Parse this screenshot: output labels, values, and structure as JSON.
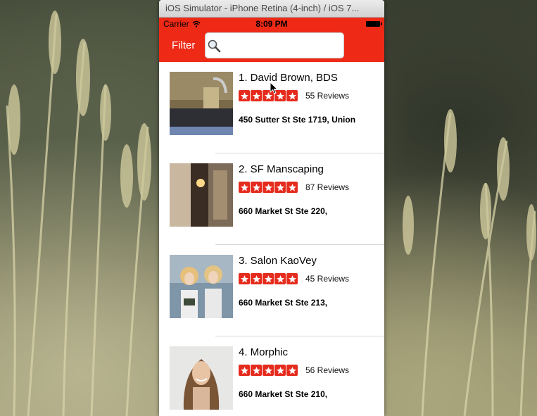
{
  "window": {
    "title": "iOS Simulator - iPhone Retina (4-inch) / iOS 7..."
  },
  "statusbar": {
    "carrier": "Carrier",
    "time": "8:09 PM"
  },
  "navbar": {
    "filter_label": "Filter",
    "search_value": "",
    "search_placeholder": ""
  },
  "colors": {
    "brand_red": "#ee2a16",
    "star_red": "#e52b1d"
  },
  "businesses": [
    {
      "name": "1. David Brown, BDS",
      "rating": 5,
      "reviews": "55 Reviews",
      "address": "450 Sutter St Ste 1719, Union"
    },
    {
      "name": "2. SF Manscaping",
      "rating": 5,
      "reviews": "87 Reviews",
      "address": "660 Market St Ste 220,"
    },
    {
      "name": "3. Salon KaoVey",
      "rating": 5,
      "reviews": "45 Reviews",
      "address": "660 Market St Ste 213,"
    },
    {
      "name": "4. Morphic",
      "rating": 5,
      "reviews": "56 Reviews",
      "address": "660 Market St Ste 210,"
    }
  ]
}
